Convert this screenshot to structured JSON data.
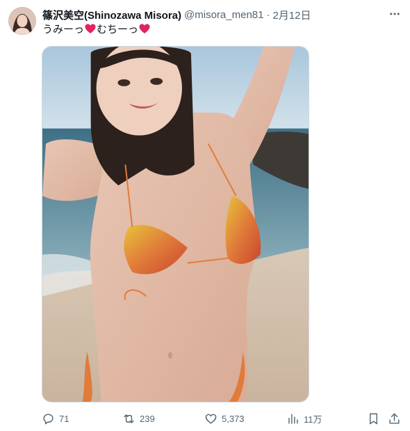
{
  "tweet": {
    "author": {
      "display_name": "篠沢美空(Shinozawa Misora)",
      "handle": "@misora_men81",
      "avatar_icon": "profile-photo"
    },
    "separator": "·",
    "date": "2月12日",
    "text": {
      "part1": "うみーっ",
      "part2": "むちーっ",
      "emoji": "heart-emoji"
    },
    "media": {
      "type": "photo",
      "description_icon": "beach-photo"
    },
    "actions": {
      "replies": "71",
      "retweets": "239",
      "likes": "5,373",
      "views": "11万"
    }
  },
  "colors": {
    "text_primary": "#0f1419",
    "text_secondary": "#536471",
    "heart_emoji": "#e0245e",
    "border": "#cfd9de"
  }
}
